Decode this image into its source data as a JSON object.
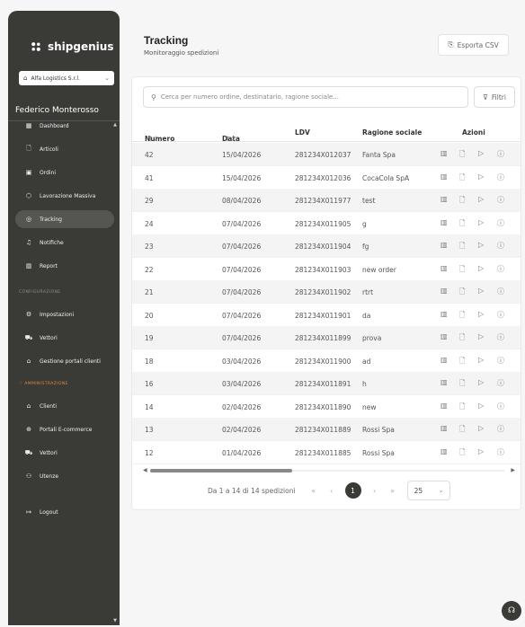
{
  "sidebar": {
    "brand": "shipgenius",
    "company": "Alfa Logistics S.r.l.",
    "user": "Federico Monterosso",
    "nav": [
      {
        "label": "Dashboard",
        "icon": "dashboard-icon",
        "glyph": "▦"
      },
      {
        "label": "Articoli",
        "icon": "file-icon",
        "glyph": "🗋"
      },
      {
        "label": "Ordini",
        "icon": "calendar-icon",
        "glyph": "▣"
      },
      {
        "label": "Lavorazione Massiva",
        "icon": "box-icon",
        "glyph": "⬡"
      },
      {
        "label": "Tracking",
        "icon": "location-icon",
        "glyph": "◎"
      },
      {
        "label": "Notifiche",
        "icon": "bell-icon",
        "glyph": "♫"
      },
      {
        "label": "Report",
        "icon": "chart-icon",
        "glyph": "▥"
      }
    ],
    "section_config": "CONFIGURAZIONE",
    "config_nav": [
      {
        "label": "Impostazioni",
        "icon": "gear-icon",
        "glyph": "⚙"
      },
      {
        "label": "Vettori",
        "icon": "truck-icon",
        "glyph": "⛟"
      },
      {
        "label": "Gestione portali clienti",
        "icon": "bank-icon",
        "glyph": "⌂"
      }
    ],
    "section_admin": "AMMINISTRAZIONE",
    "admin_nav": [
      {
        "label": "Clienti",
        "icon": "bank-icon",
        "glyph": "⌂"
      },
      {
        "label": "Portali E-commerce",
        "icon": "globe-icon",
        "glyph": "⊕"
      },
      {
        "label": "Vettori",
        "icon": "truck-icon",
        "glyph": "⛟"
      },
      {
        "label": "Utenze",
        "icon": "users-icon",
        "glyph": "⚇"
      }
    ],
    "logout": "Logout"
  },
  "header": {
    "title": "Tracking",
    "subtitle": "Monitoraggio spedizioni",
    "export_label": "Esporta CSV"
  },
  "search": {
    "placeholder": "Cerca per numero ordine, destinatario, ragione sociale..."
  },
  "filter_label": "Filtri",
  "table": {
    "columns": {
      "order": "Numero ordine",
      "date": "Data",
      "ldv": "LDV",
      "company": "Ragione sociale",
      "actions": "Azioni"
    },
    "rows": [
      {
        "order": "42",
        "date": "15/04/2026",
        "ldv": "281234X012037",
        "company": "Fanta Spa"
      },
      {
        "order": "41",
        "date": "15/04/2026",
        "ldv": "281234X012036",
        "company": "CocaCola SpA"
      },
      {
        "order": "29",
        "date": "08/04/2026",
        "ldv": "281234X011977",
        "company": "test"
      },
      {
        "order": "24",
        "date": "07/04/2026",
        "ldv": "281234X011905",
        "company": "g"
      },
      {
        "order": "23",
        "date": "07/04/2026",
        "ldv": "281234X011904",
        "company": "fg"
      },
      {
        "order": "22",
        "date": "07/04/2026",
        "ldv": "281234X011903",
        "company": "new order"
      },
      {
        "order": "21",
        "date": "07/04/2026",
        "ldv": "281234X011902",
        "company": "rtrt"
      },
      {
        "order": "20",
        "date": "07/04/2026",
        "ldv": "281234X011901",
        "company": "da"
      },
      {
        "order": "19",
        "date": "07/04/2026",
        "ldv": "281234X011899",
        "company": "prova"
      },
      {
        "order": "18",
        "date": "03/04/2026",
        "ldv": "281234X011900",
        "company": "ad"
      },
      {
        "order": "16",
        "date": "03/04/2026",
        "ldv": "281234X011891",
        "company": "h"
      },
      {
        "order": "14",
        "date": "02/04/2026",
        "ldv": "281234X011890",
        "company": "new"
      },
      {
        "order": "13",
        "date": "02/04/2026",
        "ldv": "281234X011889",
        "company": "Rossi Spa"
      },
      {
        "order": "12",
        "date": "01/04/2026",
        "ldv": "281234X011885",
        "company": "Rossi Spa"
      }
    ]
  },
  "pagination": {
    "info": "Da 1 a 14 di 14 spedizioni",
    "current": "1",
    "page_size": "25"
  }
}
